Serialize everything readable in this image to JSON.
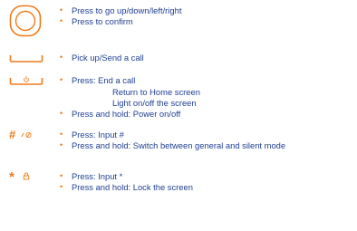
{
  "keys": [
    {
      "icon": "navigation-key-icon",
      "items": [
        {
          "text": "Press to go up/down/left/right",
          "sub": []
        },
        {
          "text": "Press to confirm",
          "sub": []
        }
      ]
    },
    {
      "icon": "call-key-icon",
      "items": [
        {
          "text": "Pick up/Send a call",
          "sub": []
        }
      ]
    },
    {
      "icon": "end-power-key-icon",
      "items": [
        {
          "text": "Press: End a call",
          "sub": [
            "Return to Home screen",
            "Light on/off the screen"
          ]
        },
        {
          "text": "Press and hold: Power on/off",
          "sub": []
        }
      ]
    },
    {
      "icon": "hash-silent-key-icon",
      "icon_glyph": "#",
      "items": [
        {
          "text": "Press: Input #",
          "sub": []
        },
        {
          "text": "Press and hold: Switch between general and silent mode",
          "sub": []
        }
      ]
    },
    {
      "icon": "star-lock-key-icon",
      "icon_glyph": "*",
      "items": [
        {
          "text": "Press: Input *",
          "sub": []
        },
        {
          "text": "Press and hold: Lock the screen",
          "sub": []
        }
      ]
    }
  ],
  "bullet": "•",
  "colors": {
    "text": "#1f3f93",
    "accent": "#f07a18"
  }
}
